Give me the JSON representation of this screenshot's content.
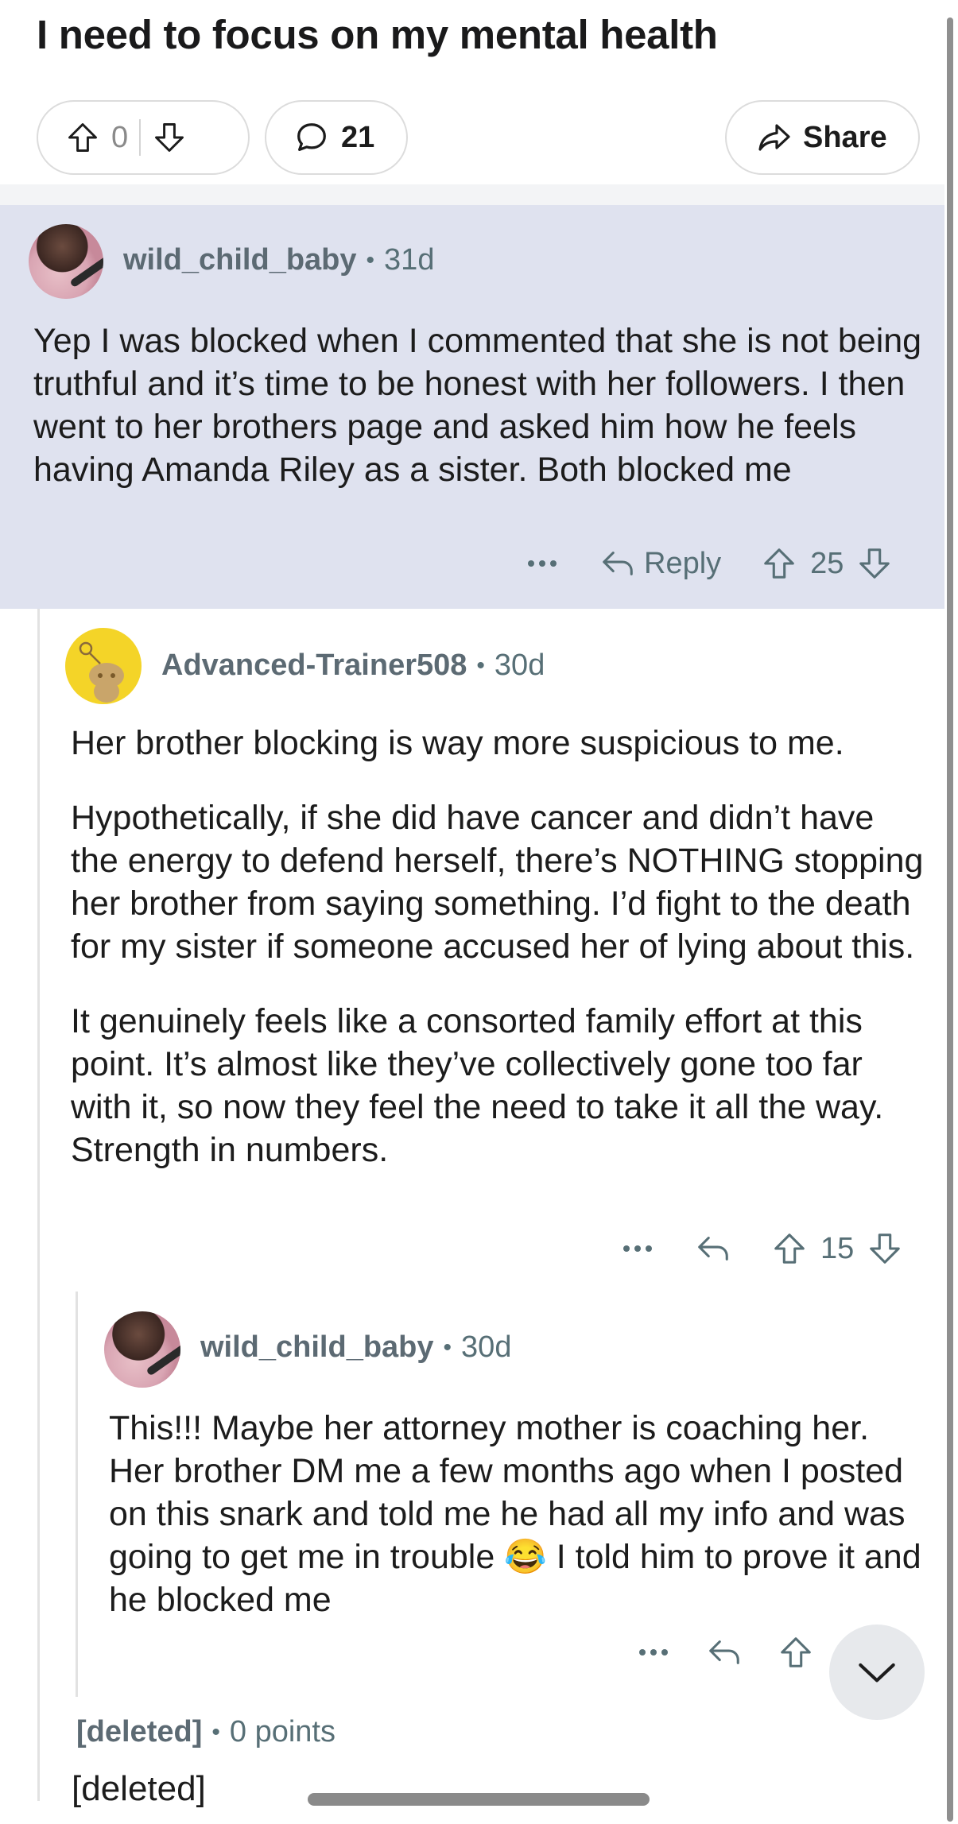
{
  "post": {
    "title": "I need to focus on my mental health",
    "vote_count": "0",
    "comment_count": "21",
    "share_label": "Share"
  },
  "comments": [
    {
      "username": "wild_child_baby",
      "age": "31d",
      "body": "Yep I was blocked when I commented that she is not being truthful and it’s time to be honest with her followers. I then went to her brothers page and asked him how he feels having Amanda Riley as a sister. Both blocked me",
      "reply_label": "Reply",
      "score": "25"
    },
    {
      "username": "Advanced-Trainer508",
      "age": "30d",
      "paragraphs": [
        "Her brother blocking is way more suspicious to me.",
        "Hypothetically, if she did have cancer and didn’t have the energy to defend herself, there’s NOTHING stopping her brother from saying something. I’d fight to the death for my sister if someone accused her of lying about this.",
        "It genuinely feels like a consorted family effort at this point. It’s almost like they’ve collectively gone too far with it, so now they feel the need to take it all the way. Strength in numbers."
      ],
      "score": "15"
    },
    {
      "username": "wild_child_baby",
      "age": "30d",
      "body_before": "This!!! Maybe her attorney mother is coaching her. Her brother DM me a few months ago when I posted on this snark and told me he had all my info and was going to get me in trouble ",
      "emoji": "😂",
      "body_after": " I told him to prove it and he blocked me"
    },
    {
      "username": "[deleted]",
      "points": "0 points",
      "body": "[deleted]"
    }
  ],
  "icons": [
    "upvote-icon",
    "downvote-icon",
    "comment-icon",
    "share-icon",
    "more-icon",
    "reply-icon",
    "chevron-down-icon"
  ]
}
